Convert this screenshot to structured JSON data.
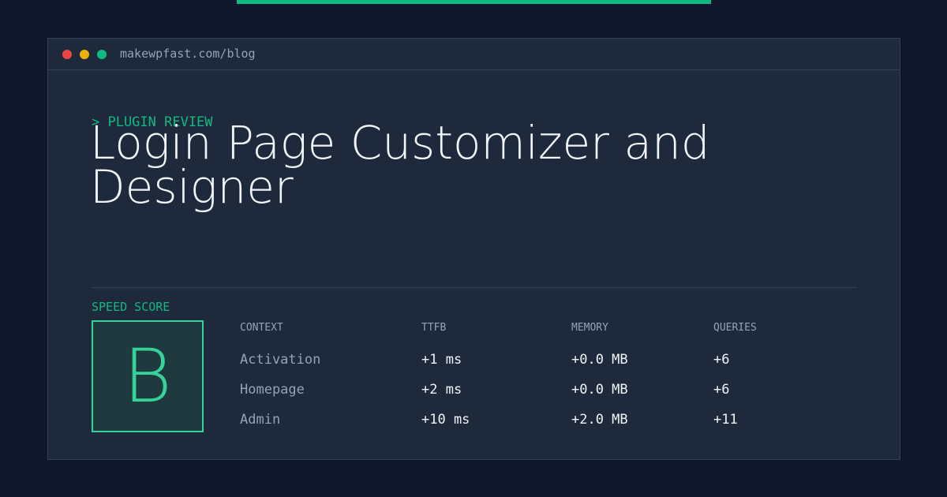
{
  "colors": {
    "page_background": "#0f172a",
    "window_background": "#1e293b",
    "accent": "#10b981",
    "grade_accent": "#34d399",
    "text_primary": "#f1f5f9",
    "text_muted": "#94a3b8"
  },
  "window": {
    "url": "makewpfast.com/blog"
  },
  "header": {
    "kicker": "> PLUGIN REVIEW",
    "title": "Login Page Customizer and Designer"
  },
  "score": {
    "label": "SPEED SCORE",
    "grade": "B"
  },
  "table": {
    "headers": [
      "CONTEXT",
      "TTFB",
      "MEMORY",
      "QUERIES"
    ],
    "rows": [
      [
        "Activation",
        "+1 ms",
        "+0.0 MB",
        "+6"
      ],
      [
        "Homepage",
        "+2 ms",
        "+0.0 MB",
        "+6"
      ],
      [
        "Admin",
        "+10 ms",
        "+2.0 MB",
        "+11"
      ]
    ]
  }
}
